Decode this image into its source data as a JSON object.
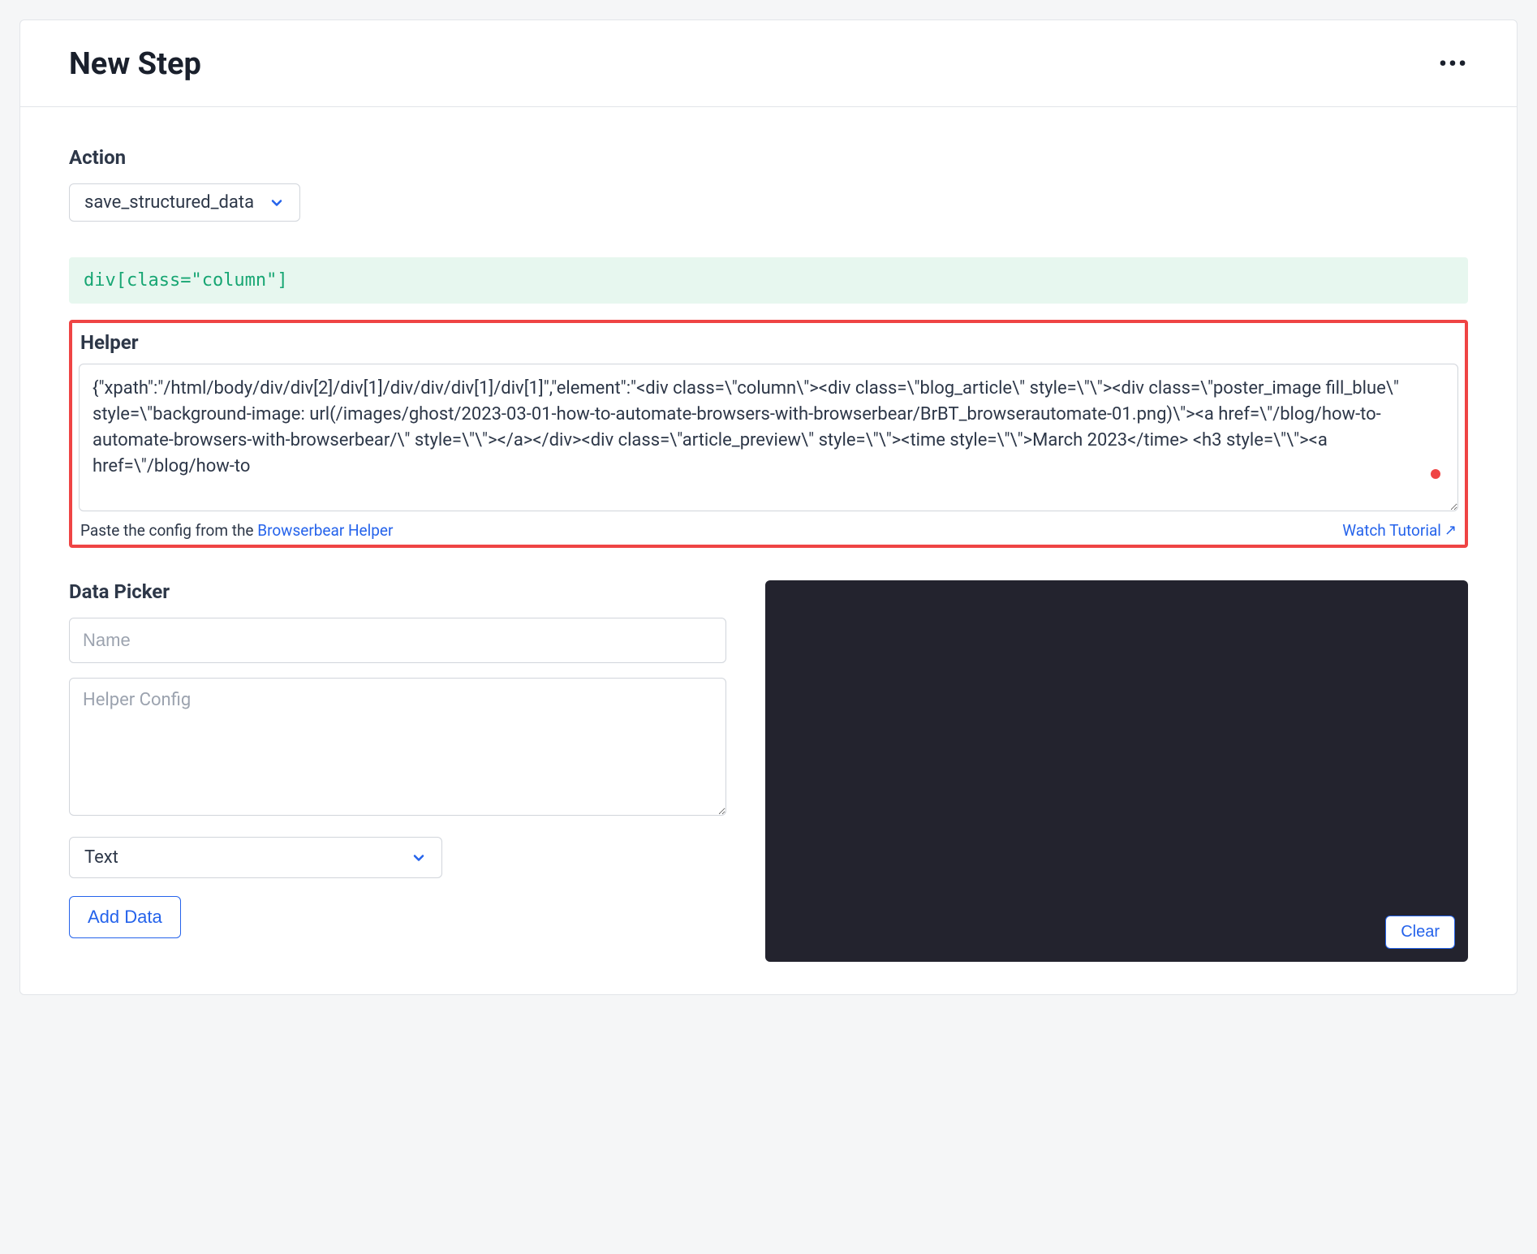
{
  "header": {
    "title": "New Step"
  },
  "action": {
    "label": "Action",
    "selected": "save_structured_data"
  },
  "selector_preview": "div[class=\"column\"]",
  "helper": {
    "label": "Helper",
    "value": "{\"xpath\":\"/html/body/div/div[2]/div[1]/div/div/div[1]/div[1]\",\"element\":\"<div class=\\\"column\\\"><div class=\\\"blog_article\\\" style=\\\"\\\"><div class=\\\"poster_image fill_blue\\\" style=\\\"background-image: url(/images/ghost/2023-03-01-how-to-automate-browsers-with-browserbear/BrBT_browserautomate-01.png)\\\"><a href=\\\"/blog/how-to-automate-browsers-with-browserbear/\\\" style=\\\"\\\"></a></div><div class=\\\"article_preview\\\" style=\\\"\\\"><time style=\\\"\\\">March 2023</time> <h3 style=\\\"\\\"><a href=\\\"/blog/how-to",
    "footer_prefix": "Paste the config from the ",
    "footer_link": "Browserbear Helper",
    "watch_tutorial": "Watch Tutorial"
  },
  "data_picker": {
    "label": "Data Picker",
    "name_placeholder": "Name",
    "config_placeholder": "Helper Config",
    "type_selected": "Text",
    "add_button": "Add Data"
  },
  "preview": {
    "clear_button": "Clear"
  }
}
